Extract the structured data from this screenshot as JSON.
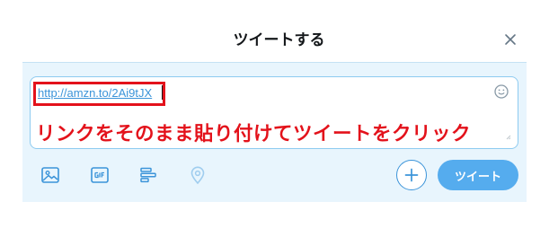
{
  "dialog": {
    "title": "ツイートする",
    "close_icon": "close-icon"
  },
  "composer": {
    "text": "http://amzn.to/2Ai9tJX",
    "emoji_icon": "emoji-icon"
  },
  "annotation": {
    "text": "リンクをそのまま貼り付けてツイートをクリック",
    "color": "#e3121b"
  },
  "toolbar": {
    "icons": [
      "image-icon",
      "gif-icon",
      "poll-icon",
      "location-icon"
    ],
    "add_icon": "plus-icon",
    "tweet_label": "ツイート"
  },
  "colors": {
    "accent": "#55acee",
    "link": "#3b94d9",
    "panel": "#e8f5fd",
    "highlight": "#e3121b"
  }
}
